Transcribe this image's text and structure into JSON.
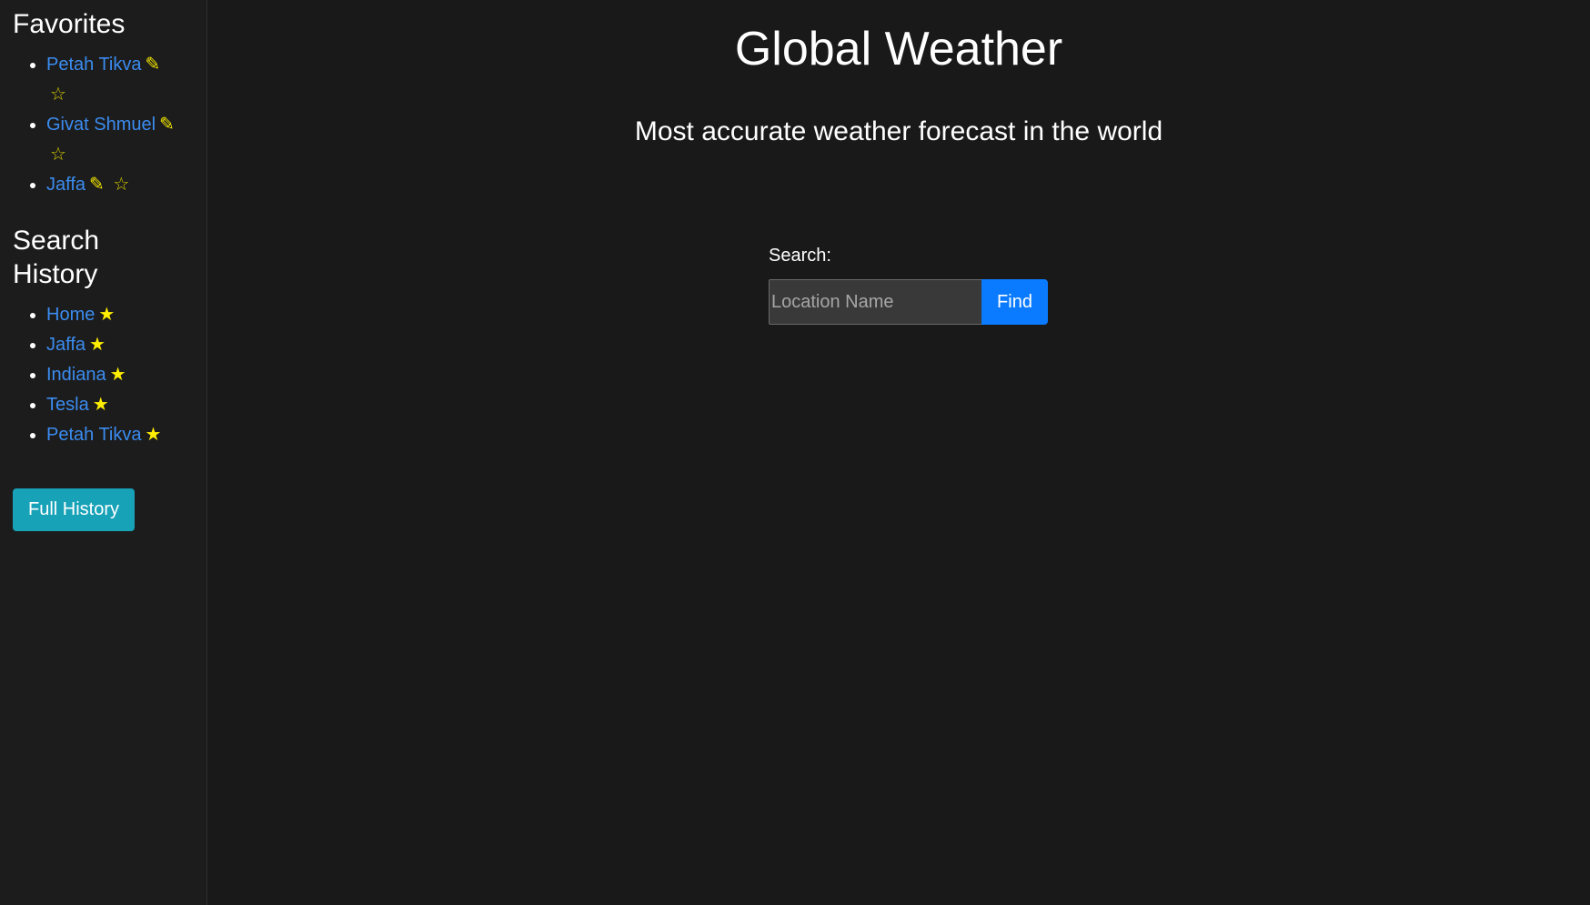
{
  "sidebar": {
    "favorites_title": "Favorites",
    "favorites": [
      {
        "label": "Petah Tikva",
        "edit_icon": "✎",
        "star_icon": "☆"
      },
      {
        "label": "Givat Shmuel",
        "edit_icon": "✎",
        "star_icon": "☆"
      },
      {
        "label": "Jaffa",
        "edit_icon": "✎",
        "star_icon": "☆"
      }
    ],
    "history_title": "Search History",
    "history": [
      {
        "label": "Home",
        "star_icon": "★"
      },
      {
        "label": "Jaffa",
        "star_icon": "★"
      },
      {
        "label": "Indiana",
        "star_icon": "★"
      },
      {
        "label": "Tesla",
        "star_icon": "★"
      },
      {
        "label": "Petah Tikva",
        "star_icon": "★"
      }
    ],
    "full_history_label": "Full History"
  },
  "main": {
    "title": "Global Weather",
    "subtitle": "Most accurate weather forecast in the world",
    "search": {
      "label": "Search:",
      "value": "",
      "placeholder": "Location Name",
      "find_label": "Find"
    }
  },
  "colors": {
    "background": "#191919",
    "link": "#3b8cf0",
    "star": "#ffee00",
    "full_history_button": "#17a2b8",
    "find_button": "#0a7bff"
  }
}
